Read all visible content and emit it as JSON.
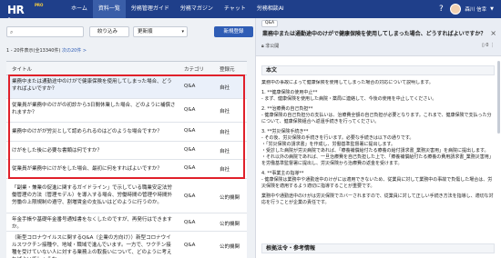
{
  "header": {
    "logo_text": "HR base",
    "logo_sub": "PRO",
    "nav": [
      "ホーム",
      "資料一覧",
      "労務管理ガイド",
      "労務マガジン",
      "チャット",
      "労務相談AI"
    ],
    "active_nav": 1,
    "user_name": "森川 信幸"
  },
  "toolbar": {
    "filter_label": "絞り込み",
    "sort_value": "更新順",
    "new_label": "新規登録"
  },
  "count": {
    "text": "1 - 20件表示(全13340件)",
    "link": "次の20件 >"
  },
  "table": {
    "headers": {
      "title": "タイトル",
      "category": "カテゴリ",
      "owner": "登録元"
    },
    "rows": [
      {
        "title": "業務中または通勤途中のけがで健康保険を使用してしまった場合、どうすればよいですか？",
        "category": "Q&A",
        "owner": "自社"
      },
      {
        "title": "従業員が業務中のけがの初診から3日間休業した場合、どのように補償されますか？",
        "category": "Q&A",
        "owner": "自社"
      },
      {
        "title": "業務中のけがが労災として認められるのはどのような場合ですか？",
        "category": "Q&A",
        "owner": "自社"
      },
      {
        "title": "けがをした後に必要な書類は何ですか？",
        "category": "Q&A",
        "owner": "自社"
      },
      {
        "title": "従業員が業務中にけがをした場合、最初に何をすればよいですか？",
        "category": "Q&A",
        "owner": "自社"
      },
      {
        "title": "「副業・兼業の促進に関するガイドライン」で示している職業安定法労働管理の方法（管理モデル）を導入する場合、労働時間の管理や時間外労働の上限規制の遵守、割増賃金の支払いはどのように行うのか。",
        "category": "Q&A",
        "owner": "公的機関"
      },
      {
        "title": "年金手帳や基礎年金番号通知書をなくしたのですが、再発行はできますか。",
        "category": "Q&A",
        "owner": "公的機関"
      },
      {
        "title": "（新型コロナウイルスに関するQ&A（企業の方向け））新型コロナウイルスワクチン接種や、地域・職域で進んでいます。一方で、ワクチン接種を受けていない人に対する業務上の取扱いについて、どのように考えればよいでしょうか。",
        "category": "Q&A",
        "owner": "公的機関"
      }
    ]
  },
  "detail": {
    "badge": "Q&A",
    "title": "業務中または通勤途中のけがで健康保険を使用してしまった場合、どうすればよいですか？",
    "sub_left": "非公開",
    "sub_right": "0",
    "section_body": "本文",
    "body": [
      "業務中の事故によって健康保険を使用してしまった場合の対応について説明します。",
      "1. **健康保険の使用中止**",
      "- まず、健康保険を使用した病院・薬局に連絡して、今後の使用を中止してください。",
      "2. **治療費の自己負担**",
      "- 健康保険の自己負担分の支払いは、治療費全額の自己負担が必要となります。これまで、健康保険で支払った分について、健康保険組合へ返還手続きを行ってください。",
      "3. **労災保険手続き**",
      "- その後、労災保険の手続きを行います。必要な手続きは以下の通りです。",
      "・「労災保険の請求書」を作成し、労働基準監督署に提出します。",
      "・受診した病院が労災病院であれば、「療養補償給付たる療養の給付請求書_業務災害用」を病院に提出します。",
      "・それ以外の病院であれば、一旦治療費を自己負担した上で、「療養補償給付たる療養の費用請求書_業務災害用」を労働基準監督署に提出し、労災保険から治療費の返金を受けます。",
      "4. **事業主の指導**",
      "- 健康保険は業務中や通勤途中のけがには適用できないため、従業員に対して業務中の事故で負傷した場合は、労災保険を適用するよう適切に指導することが重要です。",
      "業務中や通勤途中のけがは労災保険でカバーされますので、従業員に対して正しい手続き方法を指導し、適切な対応を行うことが企業の責任です。"
    ],
    "section_refs": "根拠法令・参考情報"
  }
}
